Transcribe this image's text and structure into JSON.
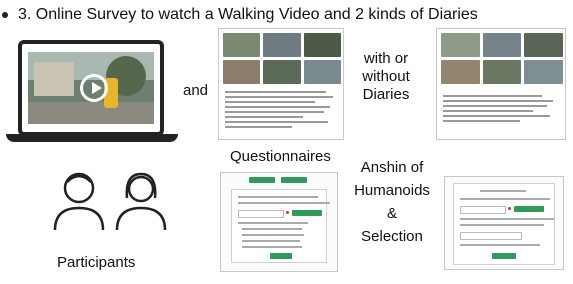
{
  "title": "3. Online Survey to watch a Walking Video and 2 kinds of Diaries",
  "and_label": "and",
  "with_or_without": [
    "with or",
    "without",
    "Diaries"
  ],
  "questionnaires_label": "Questionnaires",
  "measures_label": [
    "Anshin of",
    "Humanoids",
    "&",
    "Selection"
  ],
  "participants_label": "Participants",
  "colors": {
    "form_accent": "#2f9a5a",
    "video_robot": "#e9b52a"
  },
  "icons": [
    "play-icon",
    "laptop-icon",
    "person-icon"
  ]
}
